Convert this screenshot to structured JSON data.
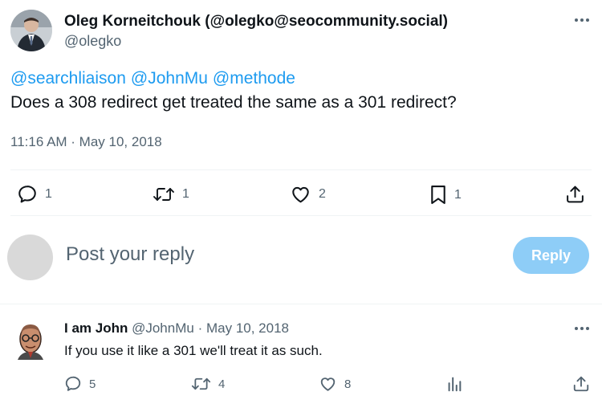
{
  "tweet": {
    "author_name": "Oleg Korneitchouk (@olegko@seocommunity.social)",
    "author_handle": "@olegko",
    "mentions": [
      "@searchliaison",
      "@JohnMu",
      "@methode"
    ],
    "text": "Does a 308 redirect get treated the same as a 301 redirect?",
    "timestamp": "11:16 AM · May 10, 2018",
    "actions": {
      "replies": "1",
      "reposts": "1",
      "likes": "2",
      "bookmarks": "1"
    }
  },
  "composer": {
    "placeholder": "Post your reply",
    "button_label": "Reply"
  },
  "reply": {
    "author_name": "I am John",
    "author_handle": "@JohnMu",
    "separator": "·",
    "date": "May 10, 2018",
    "text": "If you use it like a 301 we'll treat it as such.",
    "actions": {
      "replies": "5",
      "reposts": "4",
      "likes": "8"
    }
  },
  "icons": {
    "reply": "speech-bubble-icon",
    "repost": "repost-arrows-icon",
    "like": "heart-icon",
    "bookmark": "bookmark-icon",
    "share": "share-upload-icon",
    "views": "bar-chart-icon",
    "more": "more-dots-icon"
  },
  "colors": {
    "link": "#1d9bf0",
    "secondary_text": "#536471",
    "reply_button": "#8ecdf7",
    "divider": "#eff3f4"
  }
}
